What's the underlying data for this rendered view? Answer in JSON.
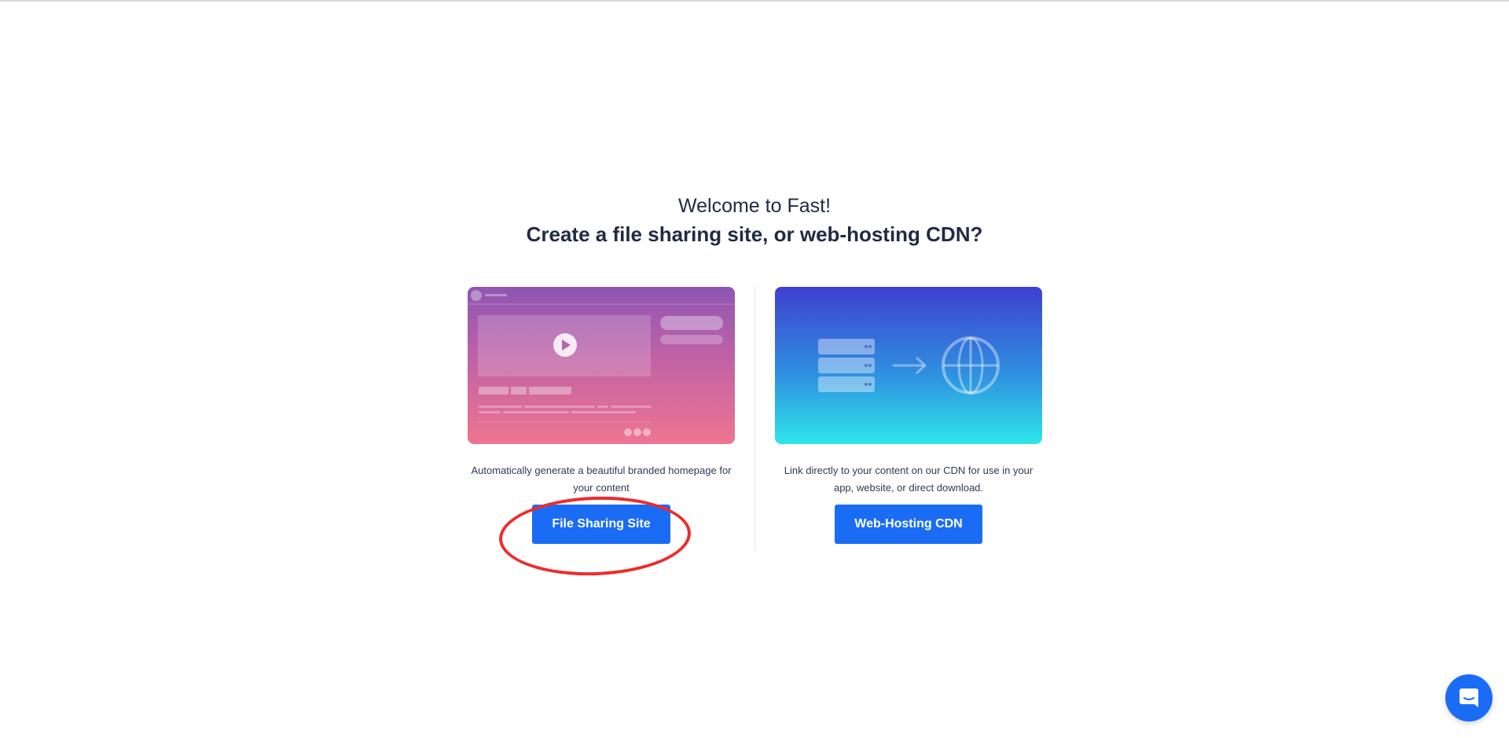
{
  "header": {
    "welcome": "Welcome to Fast!",
    "question": "Create a file sharing site, or web-hosting CDN?"
  },
  "options": {
    "file_sharing": {
      "description": "Automatically generate a beautiful branded homepage for your content",
      "button_label": "File Sharing Site",
      "illustration_icon": "branded-homepage-preview-icon"
    },
    "cdn": {
      "description": "Link directly to your content on our CDN for use in your app, website, or direct download.",
      "button_label": "Web-Hosting CDN",
      "illustration_icon": "server-to-globe-icon"
    }
  },
  "chat": {
    "icon": "chat-bubble-icon"
  },
  "colors": {
    "accent": "#1a6cf5",
    "text": "#1f2a44",
    "highlight": "#ee2b2b"
  }
}
